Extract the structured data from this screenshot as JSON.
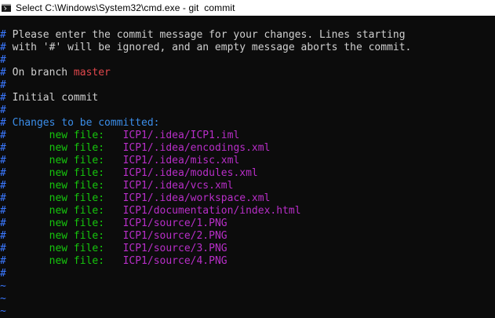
{
  "window": {
    "title": "Select C:\\Windows\\System32\\cmd.exe - git  commit"
  },
  "editor": {
    "comment_char": "#",
    "tilde_char": "~",
    "header_lines": [
      " Please enter the commit message for your changes. Lines starting",
      " with '#' will be ignored, and an empty message aborts the commit."
    ],
    "branch_prefix": " On branch ",
    "branch_name": "master",
    "initial_commit": " Initial commit",
    "changes_heading": " Changes to be committed:",
    "status_label": "new file:",
    "staged_files": [
      "ICP1/.idea/ICP1.iml",
      "ICP1/.idea/encodings.xml",
      "ICP1/.idea/misc.xml",
      "ICP1/.idea/modules.xml",
      "ICP1/.idea/vcs.xml",
      "ICP1/.idea/workspace.xml",
      "ICP1/documentation/index.html",
      "ICP1/source/1.PNG",
      "ICP1/source/2.PNG",
      "ICP1/source/3.PNG",
      "ICP1/source/4.PNG"
    ]
  },
  "colors": {
    "background": "#0c0c0c",
    "comment_marker": "#3a78ff",
    "branch": "#e0474c",
    "section_heading": "#3b8eea",
    "new_file_label": "#16c60c",
    "file_path": "#b82ec8"
  }
}
